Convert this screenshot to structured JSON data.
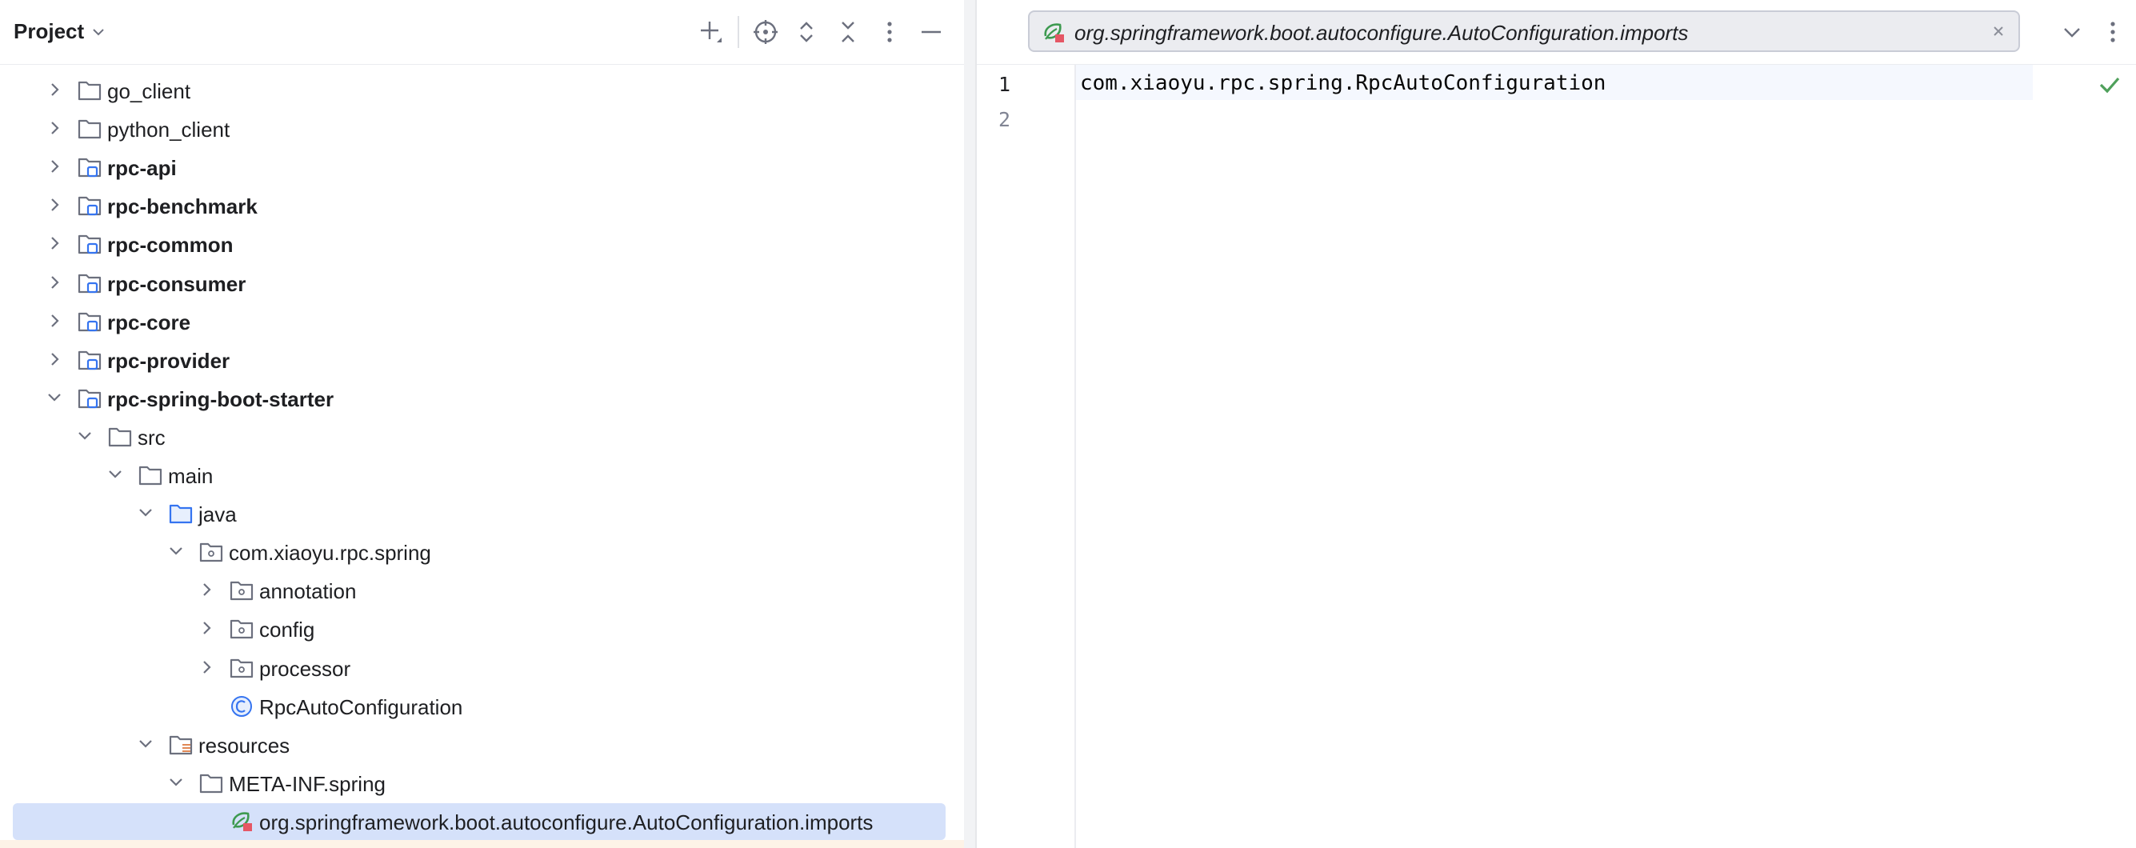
{
  "project_panel": {
    "title": "Project",
    "title_icon": "chevron-down-icon",
    "header_icons": [
      "add-icon",
      "locate-icon",
      "expand-all-icon",
      "collapse-all-icon",
      "more-options-icon",
      "minimize-icon"
    ]
  },
  "tree": {
    "rows": [
      {
        "label": "go_client",
        "icon": "folder-icon",
        "expanded": false,
        "bold": false
      },
      {
        "label": "python_client",
        "icon": "folder-icon",
        "expanded": false,
        "bold": false
      },
      {
        "label": "rpc-api",
        "icon": "module-folder-icon",
        "expanded": false,
        "bold": true
      },
      {
        "label": "rpc-benchmark",
        "icon": "module-folder-icon",
        "expanded": false,
        "bold": true
      },
      {
        "label": "rpc-common",
        "icon": "module-folder-icon",
        "expanded": false,
        "bold": true
      },
      {
        "label": "rpc-consumer",
        "icon": "module-folder-icon",
        "expanded": false,
        "bold": true
      },
      {
        "label": "rpc-core",
        "icon": "module-folder-icon",
        "expanded": false,
        "bold": true
      },
      {
        "label": "rpc-provider",
        "icon": "module-folder-icon",
        "expanded": false,
        "bold": true
      },
      {
        "label": "rpc-spring-boot-starter",
        "icon": "module-folder-icon",
        "expanded": true,
        "bold": true
      },
      {
        "label": "src",
        "icon": "folder-icon",
        "expanded": true,
        "bold": false
      },
      {
        "label": "main",
        "icon": "folder-icon",
        "expanded": true,
        "bold": false
      },
      {
        "label": "java",
        "icon": "source-folder-icon",
        "expanded": true,
        "bold": false
      },
      {
        "label": "com.xiaoyu.rpc.spring",
        "icon": "package-icon",
        "expanded": true,
        "bold": false
      },
      {
        "label": "annotation",
        "icon": "package-icon",
        "expanded": false,
        "bold": false
      },
      {
        "label": "config",
        "icon": "package-icon",
        "expanded": false,
        "bold": false
      },
      {
        "label": "processor",
        "icon": "package-icon",
        "expanded": false,
        "bold": false
      },
      {
        "label": "RpcAutoConfiguration",
        "icon": "class-icon",
        "expanded": null,
        "bold": false
      },
      {
        "label": "resources",
        "icon": "resources-folder-icon",
        "expanded": true,
        "bold": false
      },
      {
        "label": "META-INF.spring",
        "icon": "folder-icon",
        "expanded": true,
        "bold": false
      },
      {
        "label": "org.springframework.boot.autoconfigure.AutoConfiguration.imports",
        "icon": "spring-file-icon",
        "expanded": null,
        "bold": false,
        "selected": true
      }
    ]
  },
  "editor": {
    "tab_label": "org.springframework.boot.autoconfigure.AutoConfiguration.imports",
    "tab_icon": "spring-file-icon",
    "line_numbers": [
      "1",
      "2"
    ],
    "lines": [
      "com.xiaoyu.rpc.spring.RpcAutoConfiguration",
      ""
    ],
    "status_icon": "check-icon"
  },
  "colors": {
    "selection": "#d5e1fa",
    "module_badge": "#3574f0",
    "source_folder": "#3574f0",
    "spring_green": "#3d9a50",
    "check_green": "#4fa05b"
  }
}
